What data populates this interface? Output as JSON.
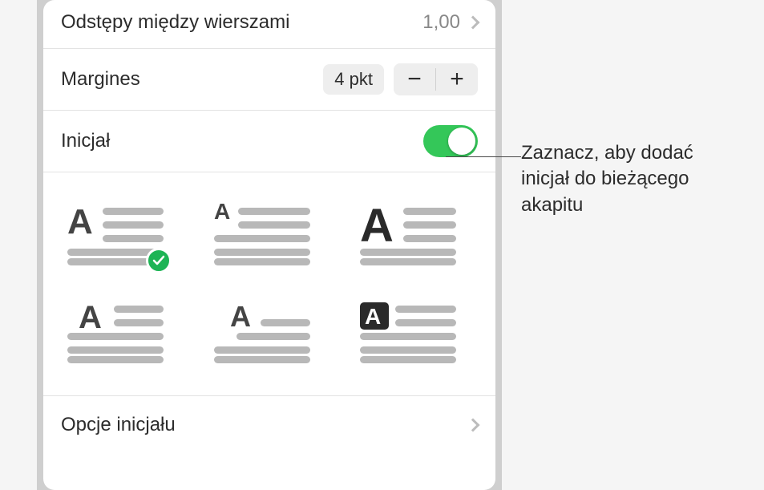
{
  "lineSpacing": {
    "label": "Odstępy między wierszami",
    "value": "1,00"
  },
  "margin": {
    "label": "Margines",
    "value": "4 pkt",
    "minus": "−",
    "plus": "+"
  },
  "dropCap": {
    "label": "Inicjał",
    "enabled": true
  },
  "styles": [
    {
      "name": "drop-cap-style-1",
      "selected": true
    },
    {
      "name": "drop-cap-style-2",
      "selected": false
    },
    {
      "name": "drop-cap-style-3",
      "selected": false
    },
    {
      "name": "drop-cap-style-4",
      "selected": false
    },
    {
      "name": "drop-cap-style-5",
      "selected": false
    },
    {
      "name": "drop-cap-style-6",
      "selected": false
    }
  ],
  "options": {
    "label": "Opcje inicjału"
  },
  "callout": "Zaznacz, aby dodać inicjał do bieżącego akapitu"
}
